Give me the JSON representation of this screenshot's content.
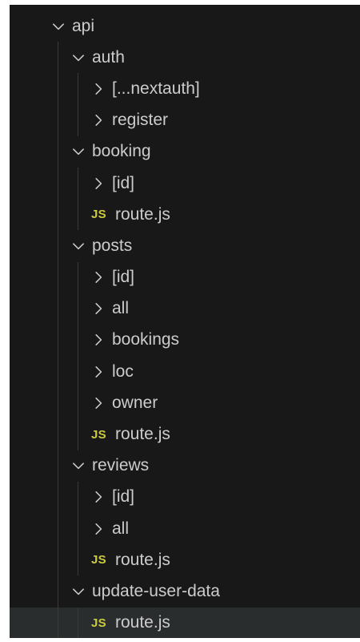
{
  "explorer": {
    "tree": [
      {
        "label": "api",
        "kind": "folder",
        "expanded": true,
        "depth": 0
      },
      {
        "label": "auth",
        "kind": "folder",
        "expanded": true,
        "depth": 1
      },
      {
        "label": "[...nextauth]",
        "kind": "folder",
        "expanded": false,
        "depth": 2
      },
      {
        "label": "register",
        "kind": "folder",
        "expanded": false,
        "depth": 2
      },
      {
        "label": "booking",
        "kind": "folder",
        "expanded": true,
        "depth": 1
      },
      {
        "label": "[id]",
        "kind": "folder",
        "expanded": false,
        "depth": 2
      },
      {
        "label": "route.js",
        "kind": "file",
        "badge": "JS",
        "depth": 2
      },
      {
        "label": "posts",
        "kind": "folder",
        "expanded": true,
        "depth": 1
      },
      {
        "label": "[id]",
        "kind": "folder",
        "expanded": false,
        "depth": 2
      },
      {
        "label": "all",
        "kind": "folder",
        "expanded": false,
        "depth": 2
      },
      {
        "label": "bookings",
        "kind": "folder",
        "expanded": false,
        "depth": 2
      },
      {
        "label": "loc",
        "kind": "folder",
        "expanded": false,
        "depth": 2
      },
      {
        "label": "owner",
        "kind": "folder",
        "expanded": false,
        "depth": 2
      },
      {
        "label": "route.js",
        "kind": "file",
        "badge": "JS",
        "depth": 2
      },
      {
        "label": "reviews",
        "kind": "folder",
        "expanded": true,
        "depth": 1
      },
      {
        "label": "[id]",
        "kind": "folder",
        "expanded": false,
        "depth": 2
      },
      {
        "label": "all",
        "kind": "folder",
        "expanded": false,
        "depth": 2
      },
      {
        "label": "route.js",
        "kind": "file",
        "badge": "JS",
        "depth": 2
      },
      {
        "label": "update-user-data",
        "kind": "folder",
        "expanded": true,
        "depth": 1
      },
      {
        "label": "route.js",
        "kind": "file",
        "badge": "JS",
        "depth": 2,
        "selected": true
      }
    ]
  },
  "colors": {
    "background": "#181818",
    "text": "#cccccc",
    "js_badge": "#cbcb41",
    "selected_row": "#2a2d2e",
    "indent_guide": "#3a3a3a"
  },
  "icons": {
    "expanded": "chevron-down-icon",
    "collapsed": "chevron-right-icon"
  }
}
